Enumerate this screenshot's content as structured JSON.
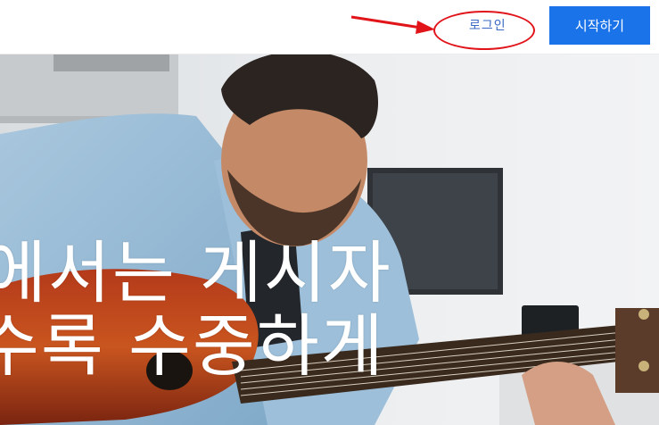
{
  "header": {
    "login_label": "로그인",
    "start_label": "시작하기"
  },
  "hero": {
    "headline_line1": "에서는 게시자",
    "headline_line2": "수록 수중하게"
  },
  "colors": {
    "primary_button": "#1a73e8",
    "login_text": "#3b68c4",
    "annotation": "#e1141a"
  }
}
